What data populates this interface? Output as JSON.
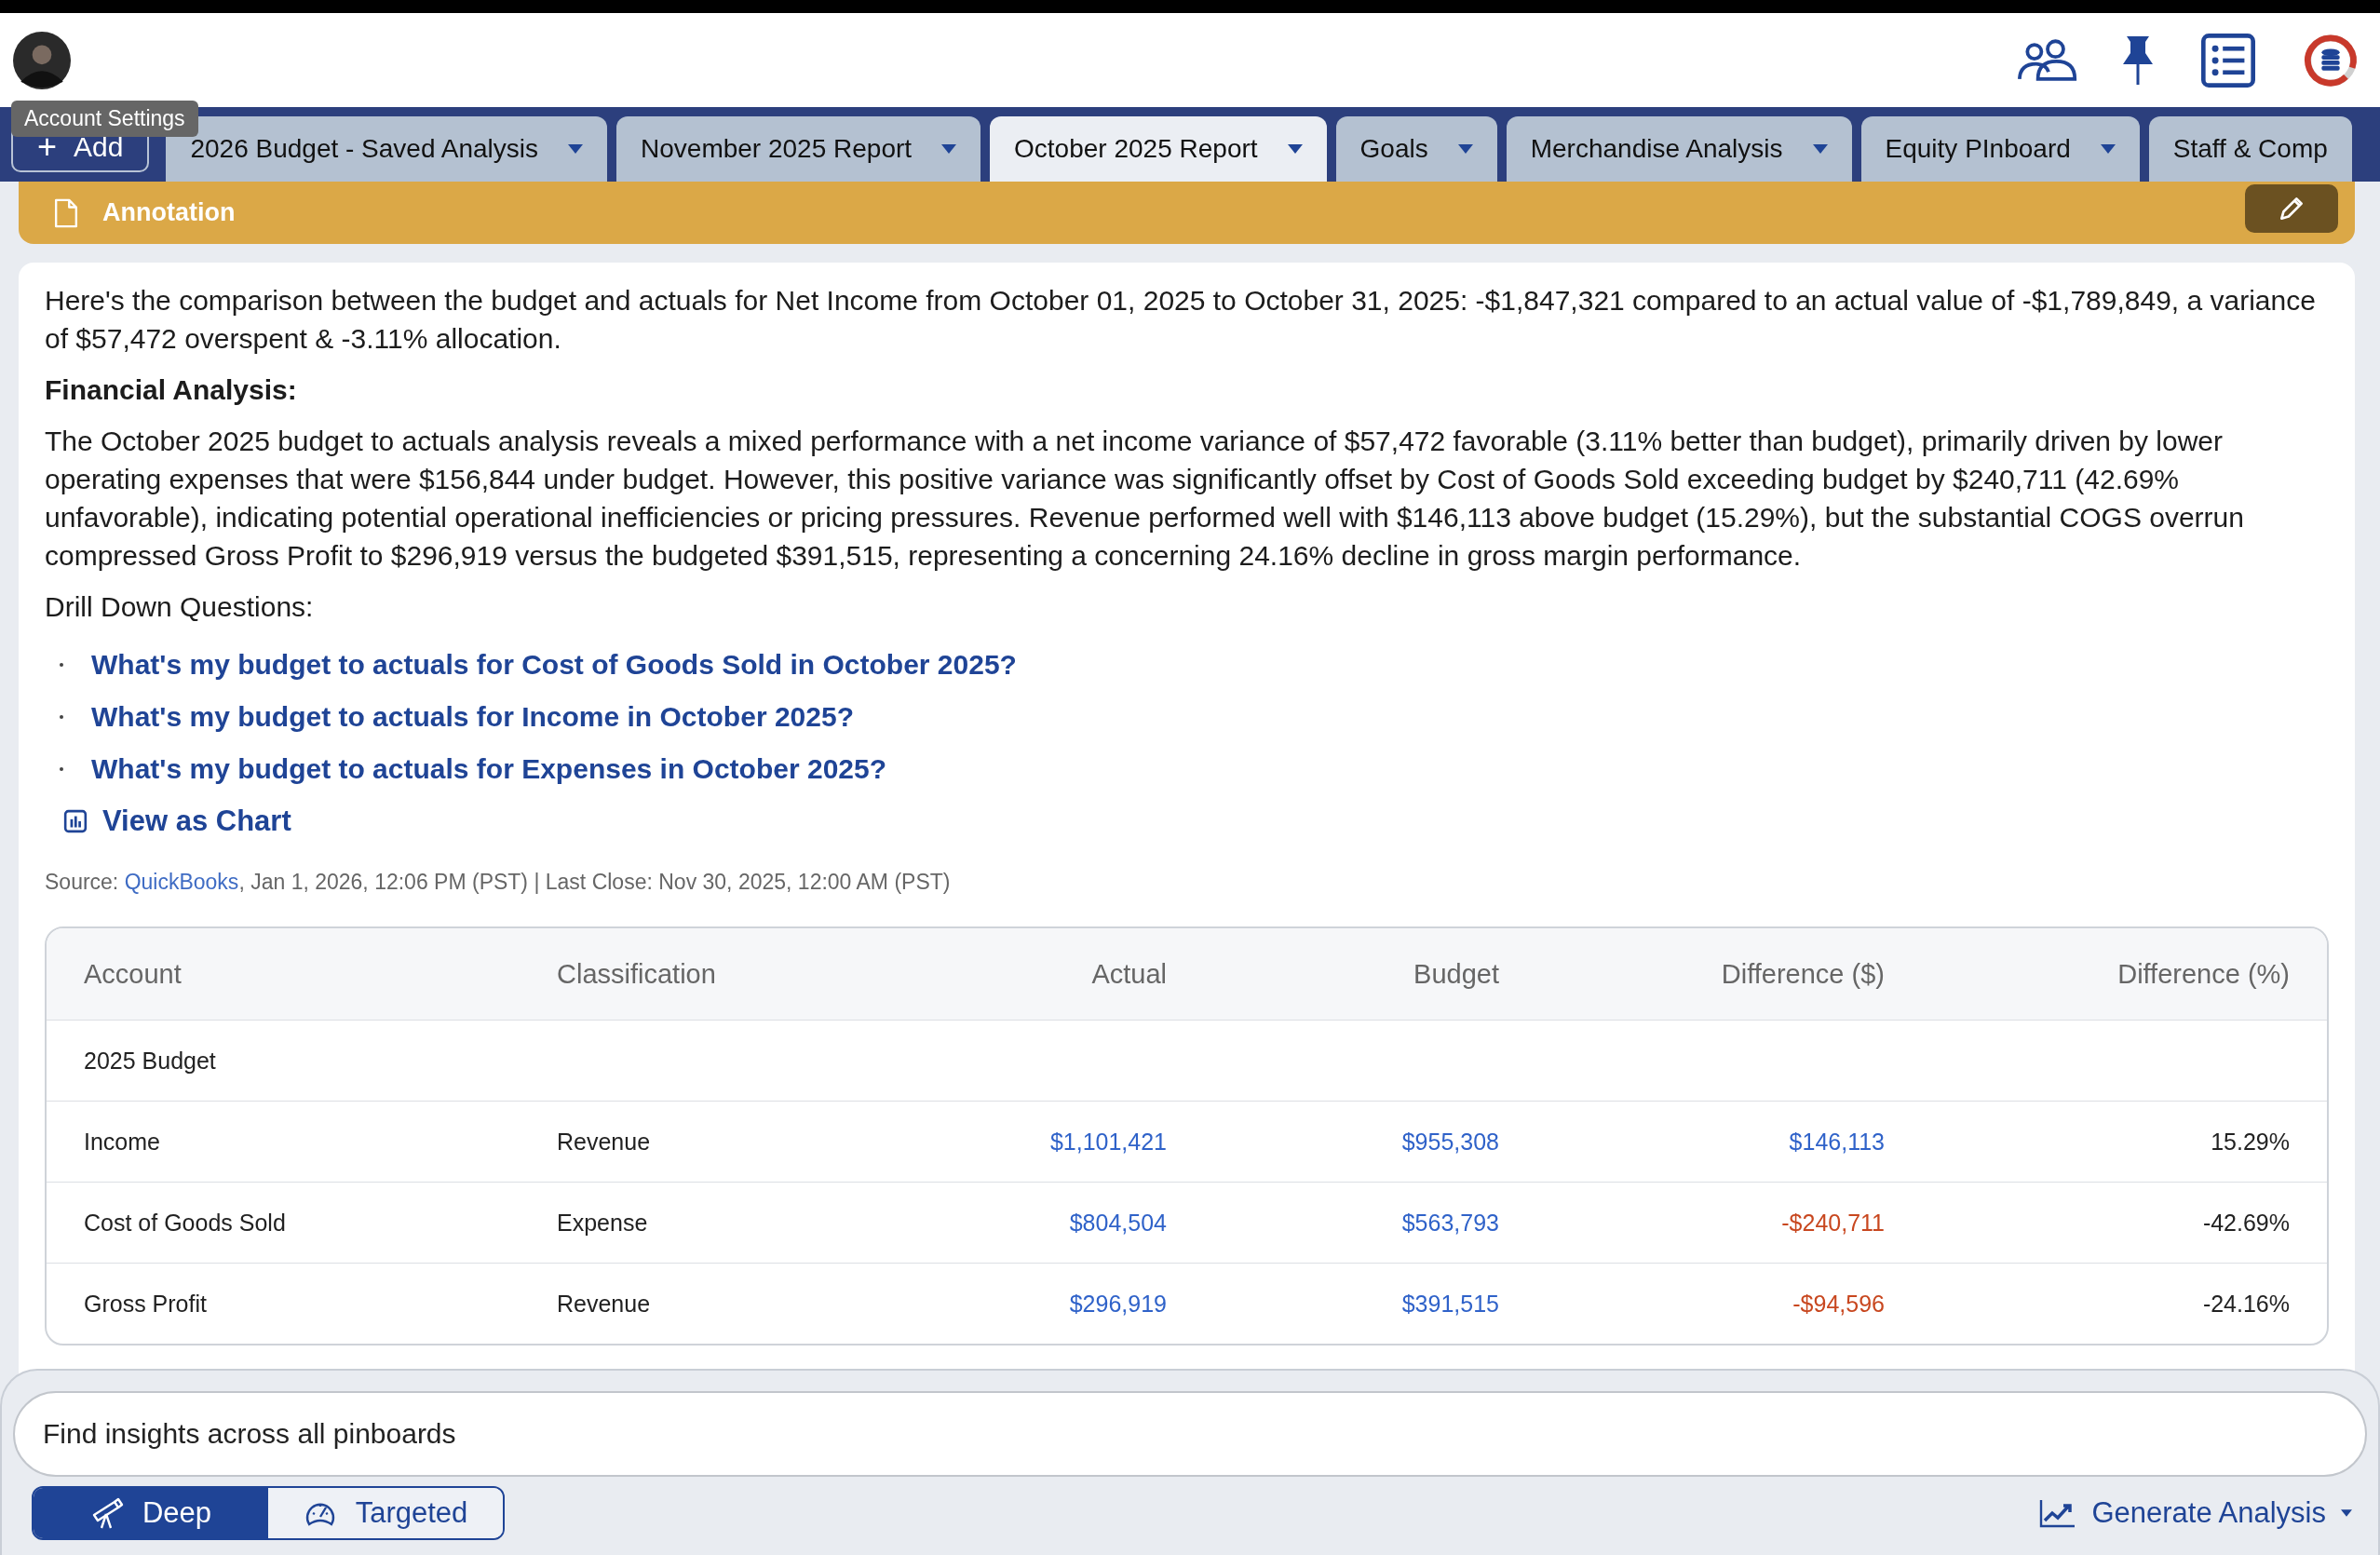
{
  "header": {
    "tooltip": "Account Settings"
  },
  "tab_bar": {
    "add_symbol": "+",
    "add_label": "Add",
    "tabs": [
      {
        "label": "2026 Budget - Saved Analysis",
        "selected": false,
        "caret": true
      },
      {
        "label": "November 2025 Report",
        "selected": false,
        "caret": true
      },
      {
        "label": "October 2025 Report",
        "selected": true,
        "caret": true
      },
      {
        "label": "Goals",
        "selected": false,
        "caret": true
      },
      {
        "label": "Merchandise Analysis",
        "selected": false,
        "caret": true
      },
      {
        "label": "Equity PInboard",
        "selected": false,
        "caret": true
      },
      {
        "label": "Staff & Comp",
        "selected": false,
        "caret": false
      }
    ]
  },
  "annotation": {
    "title": "Annotation"
  },
  "summary": {
    "intro": "Here's the comparison between the budget and actuals for Net Income from October 01, 2025 to October 31, 2025: -$1,847,321 compared to an actual value of -$1,789,849, a variance of $57,472 overspent & -3.11% allocation.",
    "heading": "Financial Analysis:",
    "analysis": "The October 2025 budget to actuals analysis reveals a mixed performance with a net income variance of $57,472 favorable (3.11% better than budget), primarily driven by lower operating expenses that were $156,844 under budget. However, this positive variance was significantly offset by Cost of Goods Sold exceeding budget by $240,711 (42.69% unfavorable), indicating potential operational inefficiencies or pricing pressures. Revenue performed well with $146,113 above budget (15.29%), but the substantial COGS overrun compressed Gross Profit to $296,919 versus the budgeted $391,515, representing a concerning 24.16% decline in gross margin performance.",
    "drill_heading": "Drill Down Questions:",
    "questions": [
      "What's my budget to actuals for Cost of Goods Sold in October 2025?",
      "What's my budget to actuals for Income in October 2025?",
      "What's my budget to actuals for Expenses in October 2025?"
    ],
    "chart_link": "View as Chart",
    "source": {
      "label": "Source: ",
      "link": "QuickBooks",
      "rest": ", Jan 1, 2026, 12:06 PM (PST) | Last Close: Nov 30, 2025, 12:00 AM (PST)"
    }
  },
  "table": {
    "columns": [
      "Account",
      "Classification",
      "Actual",
      "Budget",
      "Difference ($)",
      "Difference (%)"
    ],
    "rows": [
      {
        "kind": "group",
        "account": "2025 Budget"
      },
      {
        "kind": "line",
        "account": "Income",
        "classification": "Revenue",
        "actual": "$1,101,421",
        "budget": "$955,308",
        "difference": "$146,113",
        "percent": "15.29%",
        "negative": false
      },
      {
        "kind": "line",
        "account": "Cost of Goods Sold",
        "classification": "Expense",
        "actual": "$804,504",
        "budget": "$563,793",
        "difference": "-$240,711",
        "percent": "-42.69%",
        "negative": true
      },
      {
        "kind": "line",
        "account": "Gross Profit",
        "classification": "Revenue",
        "actual": "$296,919",
        "budget": "$391,515",
        "difference": "-$94,596",
        "percent": "-24.16%",
        "negative": true
      }
    ]
  },
  "bottom": {
    "placeholder": "Find insights across all pinboards",
    "modes": [
      {
        "label": "Deep",
        "kind": "telescope",
        "selected": true
      },
      {
        "label": "Targeted",
        "kind": "gauge",
        "selected": false
      }
    ],
    "generate": "Generate Analysis"
  }
}
